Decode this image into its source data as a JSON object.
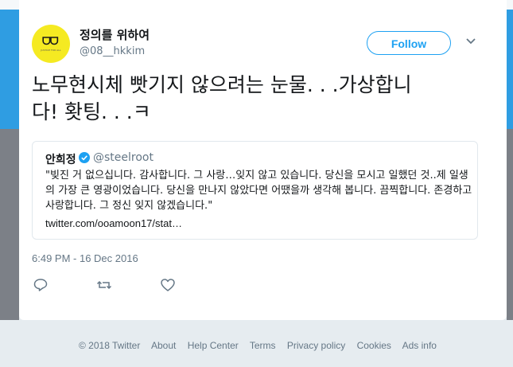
{
  "tweet": {
    "author_name": "정의를 위하여",
    "author_handle": "@08__hkkim",
    "follow_label": "Follow",
    "text_line1": "노무현시체 빳기지 않으려는 눈물. . .가상합니",
    "text_line2": "다! 홧팅. . .ㅋ",
    "timestamp": "6:49 PM - 16 Dec 2016"
  },
  "avatar": {
    "glyph": "ᗜᗜ",
    "caption": "JUSTICE FOR ALL"
  },
  "quote": {
    "author_name": "안희정",
    "author_handle": "@steelroot",
    "text": "\"빚진 거 없으십니다. 감사합니다. 그 사랑…잊지 않고 있습니다. 당신을 모시고 일했던 것..제 일생의 가장 큰 영광이었습니다. 당신을 만나지 않았다면 어땠을까 생각해 봅니다. 끔찍합니다. 존경하고 사랑합니다. 그 정신 잊지 않겠습니다.\"",
    "link": "twitter.com/ooamoon17/stat…"
  },
  "actions": {
    "reply_icon": "reply-icon",
    "retweet_icon": "retweet-icon",
    "like_icon": "heart-icon"
  },
  "footer": {
    "links": [
      "© 2018 Twitter",
      "About",
      "Help Center",
      "Terms",
      "Privacy policy",
      "Cookies",
      "Ads info"
    ]
  },
  "colors": {
    "accent": "#1da1f2",
    "muted": "#657786",
    "avatar_bg": "#f5ea22",
    "page_bg": "#e6ecf0"
  }
}
